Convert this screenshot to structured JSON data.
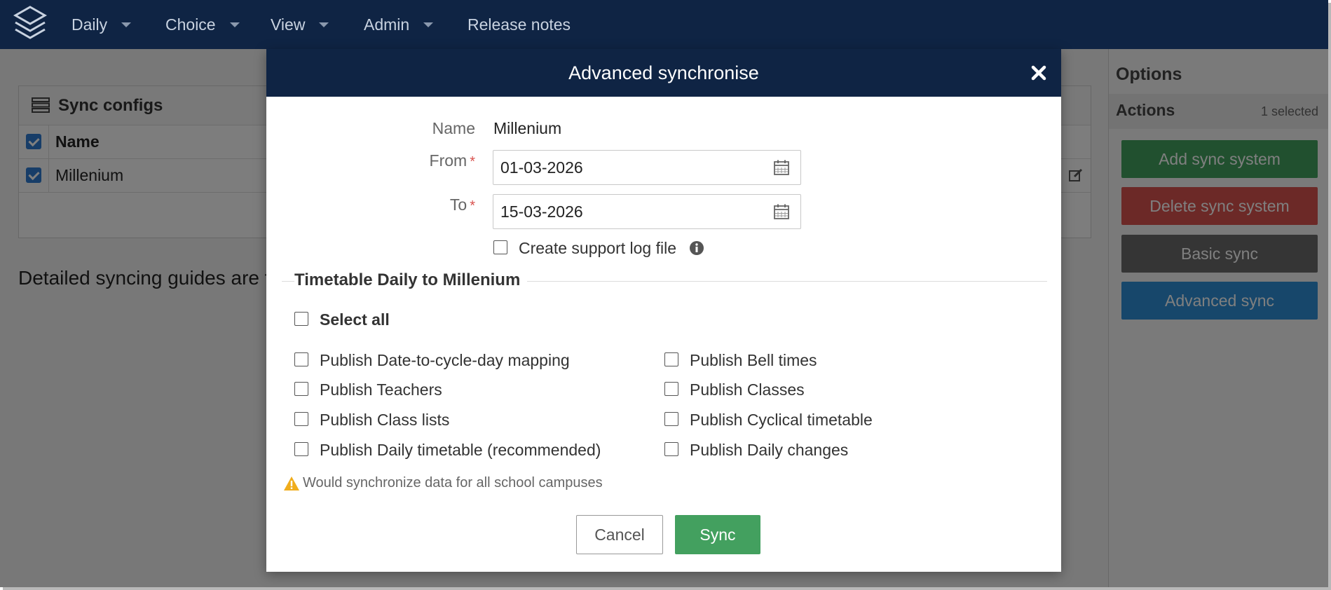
{
  "nav": {
    "items": [
      {
        "label": "Daily"
      },
      {
        "label": "Choice"
      },
      {
        "label": "View"
      },
      {
        "label": "Admin"
      },
      {
        "label": "Release notes"
      }
    ]
  },
  "background": {
    "panel_title": "Sync configs",
    "column_name": "Name",
    "rows": [
      {
        "name": "Millenium"
      }
    ],
    "guides_text": "Detailed syncing guides are fo"
  },
  "sidebar": {
    "options_title": "Options",
    "actions_title": "Actions",
    "selected_count": "1 selected",
    "buttons": [
      {
        "label": "Add sync system",
        "color": "#43a05f"
      },
      {
        "label": "Delete sync system",
        "color": "#d9534f"
      },
      {
        "label": "Basic sync",
        "color": "#6b6b6b"
      },
      {
        "label": "Advanced sync",
        "color": "#2e8fd6"
      }
    ]
  },
  "modal": {
    "title": "Advanced synchronise",
    "name_label": "Name",
    "name_value": "Millenium",
    "from_label": "From",
    "from_value": "01-03-2026",
    "to_label": "To",
    "to_value": "15-03-2026",
    "required_mark": "*",
    "support_log_label": "Create support log file",
    "section_title": "Timetable Daily to Millenium",
    "select_all_label": "Select all",
    "options_left": [
      "Publish Date-to-cycle-day mapping",
      "Publish Teachers",
      "Publish Class lists",
      "Publish Daily timetable (recommended)"
    ],
    "options_right": [
      "Publish Bell times",
      "Publish Classes",
      "Publish Cyclical timetable",
      "Publish Daily changes"
    ],
    "warning": "Would synchronize data for all school campuses",
    "cancel_label": "Cancel",
    "sync_label": "Sync"
  },
  "colors": {
    "nav_bg": "#0f2444",
    "primary_green": "#43a05f",
    "danger_red": "#d9534f",
    "warning_amber": "#f0ad1c"
  }
}
